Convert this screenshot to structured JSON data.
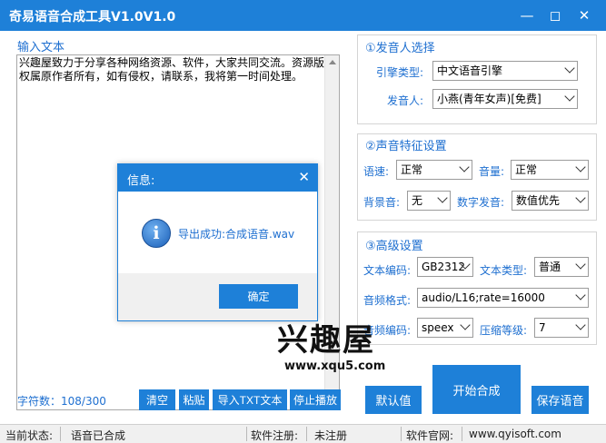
{
  "window": {
    "title": "奇易语音合成工具V1.0V1.0",
    "min_icon": "minimize-icon",
    "max_icon": "maximize-icon",
    "close_icon": "close-icon"
  },
  "input": {
    "label": "输入文本",
    "text": "兴趣屋致力于分享各种网络资源、软件，大家共同交流。资源版权属原作者所有，如有侵权，请联系，我将第一时间处理。",
    "char_count": "字符数：108/300"
  },
  "buttons": {
    "clear": "清空",
    "paste": "粘贴",
    "import_txt": "导入TXT文本",
    "stop": "停止播放",
    "default": "默认值",
    "start": "开始合成",
    "save": "保存语音"
  },
  "speaker": {
    "title": "①发音人选择",
    "engine_label": "引擎类型:",
    "engine_value": "中文语音引擎",
    "voice_label": "发音人:",
    "voice_value": "小燕(青年女声)[免费]"
  },
  "voice_features": {
    "title": "②声音特征设置",
    "speed_label": "语速:",
    "speed_value": "正常",
    "volume_label": "音量:",
    "volume_value": "正常",
    "bgm_label": "背景音:",
    "bgm_value": "无",
    "digit_label": "数字发音:",
    "digit_value": "数值优先"
  },
  "advanced": {
    "title": "③高级设置",
    "encoding_label": "文本编码:",
    "encoding_value": "GB2312",
    "texttype_label": "文本类型:",
    "texttype_value": "普通",
    "format_label": "音频格式:",
    "format_value": "audio/L16;rate=16000",
    "codec_label": "音频编码:",
    "codec_value": "speex",
    "level_label": "压缩等级:",
    "level_value": "7"
  },
  "dialog": {
    "title": "信息:",
    "message": "导出成功:合成语音.wav",
    "ok": "确定",
    "icon": "info-icon"
  },
  "watermark": {
    "text": "兴趣屋",
    "url": "www.xqu5.com"
  },
  "status": {
    "state_label": "当前状态:",
    "state_value": "语音已合成",
    "reg_label": "软件注册:",
    "reg_value": "未注册",
    "site_label": "软件官网:",
    "site_value": "www.qyisoft.com"
  }
}
